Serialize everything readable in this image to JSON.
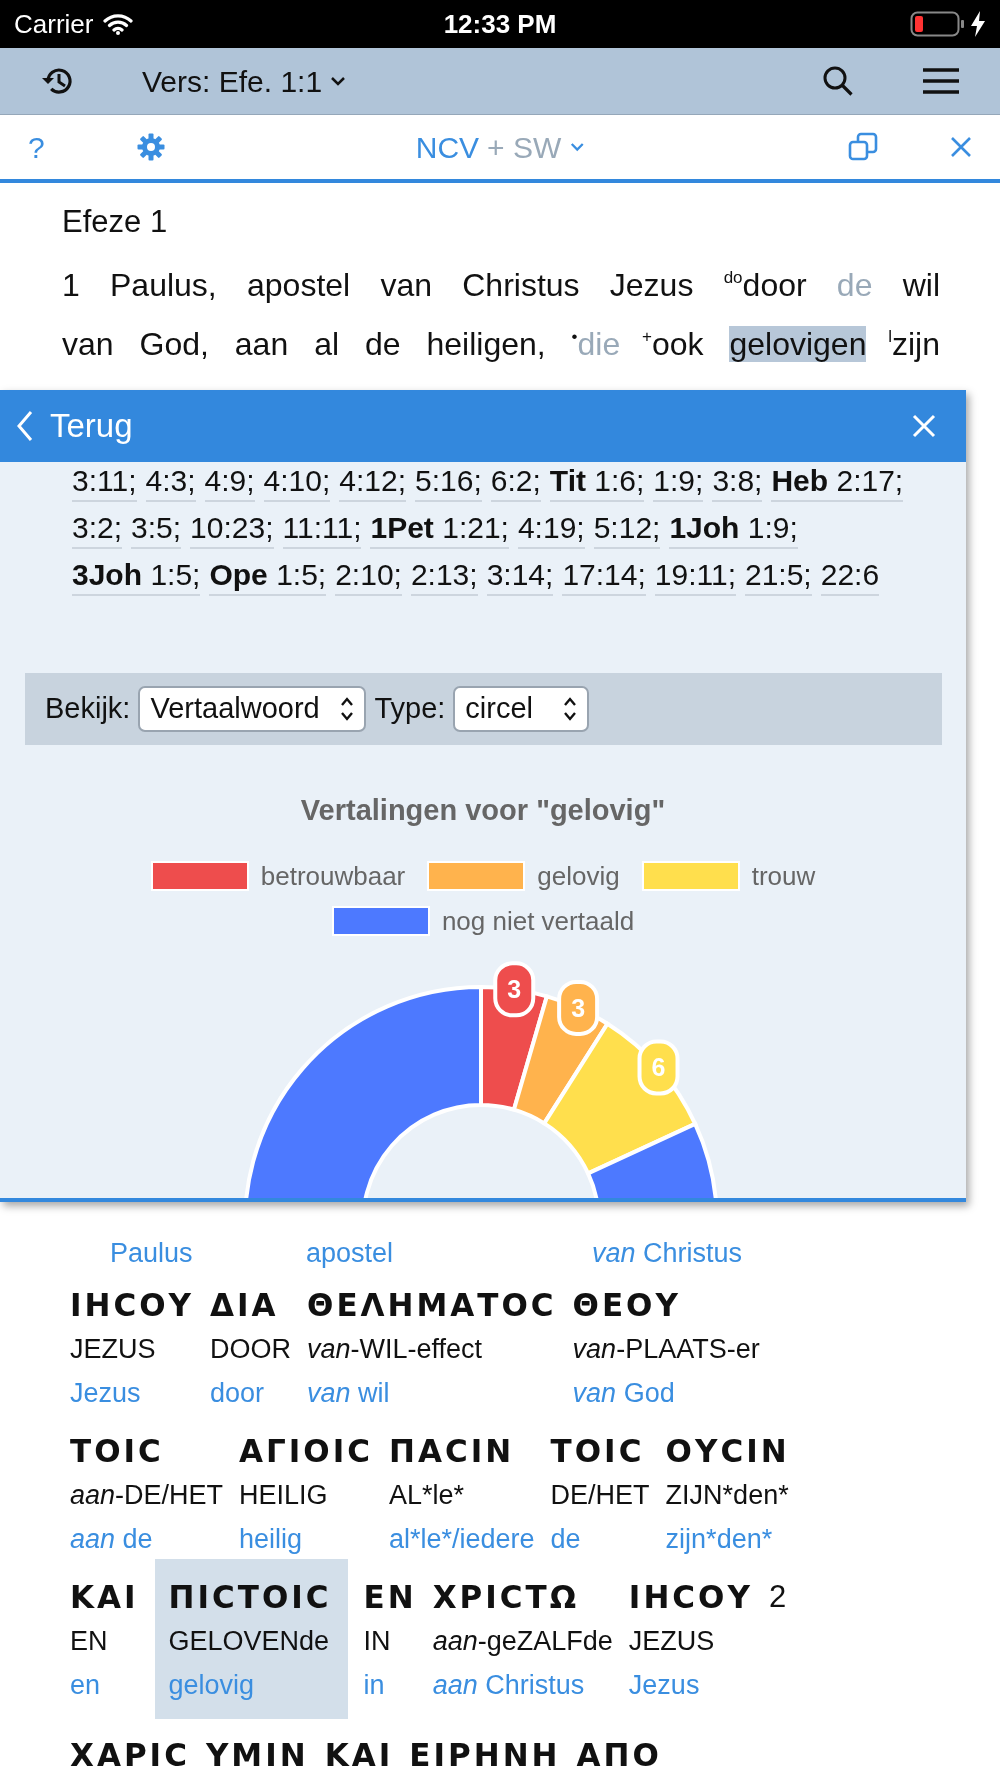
{
  "status_bar": {
    "carrier": "Carrier",
    "time": "12:33 PM"
  },
  "nav_bar": {
    "verse_picker": "Vers: Efe. 1:1"
  },
  "toolbar": {
    "help": "?",
    "translation": [
      {
        "text": "NCV",
        "active": true
      },
      {
        "text": "+ SW",
        "active": false
      }
    ]
  },
  "chapter_title": "Efeze 1",
  "verse_lines": [
    [
      {
        "kind": "text",
        "text": "1 Paulus, apostel van Christus Jezus "
      },
      {
        "kind": "marker",
        "text": "do"
      },
      {
        "kind": "text",
        "text": "door "
      },
      {
        "kind": "faded",
        "text": "de"
      },
      {
        "kind": "text",
        "text": " wil"
      }
    ],
    [
      {
        "kind": "text",
        "text": "van God, aan al de heiligen, "
      },
      {
        "kind": "marker",
        "text": "•"
      },
      {
        "kind": "faded",
        "text": "die"
      },
      {
        "kind": "marker",
        "text": " +"
      },
      {
        "kind": "text",
        "text": "ook "
      },
      {
        "kind": "highlight",
        "text": "gelovigen"
      },
      {
        "kind": "marker",
        "text": " l"
      },
      {
        "kind": "text",
        "text": "zijn"
      }
    ]
  ],
  "popup": {
    "back": "Terug",
    "references": [
      {
        "ref": "3:11;"
      },
      {
        "ref": "4:3;"
      },
      {
        "ref": "4:9;"
      },
      {
        "ref": "4:10;"
      },
      {
        "ref": "4:12;"
      },
      {
        "ref": "5:16;"
      },
      {
        "ref": "6:2;"
      },
      {
        "book": "Tit",
        "ref": "1:6;"
      },
      {
        "ref": "1:9;"
      },
      {
        "ref": "3:8;"
      },
      {
        "book": "Heb",
        "ref": "2:17;"
      },
      {
        "ref": "3:2;"
      },
      {
        "ref": "3:5;"
      },
      {
        "ref": "10:23;"
      },
      {
        "ref": "11:11;"
      },
      {
        "book": "1Pet",
        "ref": "1:21;"
      },
      {
        "ref": "4:19;"
      },
      {
        "ref": "5:12;"
      },
      {
        "book": "1Joh",
        "ref": "1:9;"
      },
      {
        "book": "3Joh",
        "ref": "1:5;"
      },
      {
        "book": "Ope",
        "ref": "1:5;"
      },
      {
        "ref": "2:10;"
      },
      {
        "ref": "2:13;"
      },
      {
        "ref": "3:14;"
      },
      {
        "ref": "17:14;"
      },
      {
        "ref": "19:11;"
      },
      {
        "ref": "21:5;"
      },
      {
        "ref": "22:6"
      }
    ],
    "filter": {
      "view_label": "Bekijk:",
      "view_value": "Vertaalwoord",
      "type_label": "Type:",
      "type_value": "circel"
    },
    "chart_data": {
      "type": "donut",
      "title": "Vertalingen voor \"gelovig\"",
      "categories": [
        "betrouwbaar",
        "gelovig",
        "trouw",
        "nog niet vertaald"
      ],
      "series": [
        {
          "values": [
            4.5,
            4.5,
            9.1,
            81.9
          ]
        }
      ],
      "colors": [
        "#ee4d4d",
        "#ffb34d",
        "#ffdf4d",
        "#4d79ff"
      ],
      "value_labels": [
        "3",
        "3",
        "6",
        null
      ],
      "legend": "top"
    }
  },
  "interlinear": [
    {
      "words": [
        {
          "kind": "word",
          "translation": "Paulus",
          "selected": false
        },
        {
          "kind": "word",
          "translation": "apostel",
          "selected": false
        },
        {
          "kind": "word",
          "translation": "*van* Christus",
          "selected": false
        }
      ]
    },
    {
      "words": [
        {
          "kind": "word",
          "greek": "ΙΗϹΟΥ",
          "gloss": "JEZUS",
          "translation": "Jezus",
          "selected": false
        },
        {
          "kind": "word",
          "greek": "ΔΙΑ",
          "gloss": "DOOR",
          "translation": "door",
          "selected": false
        },
        {
          "kind": "word",
          "greek": "ΘΕΛΗΜΑΤΟϹ",
          "gloss": "*van*-WIL-effect",
          "translation": "*van* wil",
          "selected": false
        },
        {
          "kind": "word",
          "greek": "ΘΕΟΥ",
          "gloss": "*van*-PLAATS-er",
          "translation": "*van* God",
          "selected": false
        }
      ]
    },
    {
      "words": [
        {
          "kind": "word",
          "greek": "ΤΟΙϹ",
          "gloss": "*aan*-DE/HET",
          "translation": "*aan* de",
          "selected": false
        },
        {
          "kind": "word",
          "greek": "ΑΓΙΟΙϹ",
          "gloss": "HEILIG",
          "translation": "heilig",
          "selected": false
        },
        {
          "kind": "word",
          "greek": "ΠΑϹΙΝ",
          "gloss": "AL*le*",
          "translation": "al*le*/iedere",
          "selected": false
        },
        {
          "kind": "word",
          "greek": "ΤΟΙϹ",
          "gloss": "DE/HET",
          "translation": "de",
          "selected": false
        },
        {
          "kind": "word",
          "greek": "ΟΥϹΙΝ",
          "gloss": "ZIJN*den*",
          "translation": "zijn*den*",
          "selected": false
        }
      ]
    },
    {
      "words": [
        {
          "kind": "word",
          "greek": "ΚΑΙ",
          "gloss": "EN",
          "translation": "en",
          "selected": false
        },
        {
          "kind": "word",
          "greek": "ΠΙϹΤΟΙϹ",
          "gloss": "GELOVENde",
          "translation": "gelovig",
          "selected": true
        },
        {
          "kind": "word",
          "greek": "ΕΝ",
          "gloss": "IN",
          "translation": "in",
          "selected": false
        },
        {
          "kind": "word",
          "greek": "ΧΡΙϹΤΩ",
          "gloss": "*aan*-geZALFde",
          "translation": "*aan* Christus",
          "selected": false
        },
        {
          "kind": "word",
          "greek": "ΙΗϹΟΥ",
          "gloss": "JEZUS",
          "translation": "Jezus",
          "selected": false
        },
        {
          "kind": "verse_number",
          "greek": "2",
          "selected": false
        }
      ]
    },
    {
      "words": [
        {
          "kind": "word",
          "greek": "ΧΑΡΙϹ",
          "selected": false
        },
        {
          "kind": "word",
          "greek": "ΥΜΙΝ",
          "selected": false
        },
        {
          "kind": "word",
          "greek": "ΚΑΙ",
          "selected": false
        },
        {
          "kind": "word",
          "greek": "ΕΙΡΗΝΗ",
          "selected": false
        },
        {
          "kind": "word",
          "greek": "ΑΠΟ",
          "selected": false
        }
      ]
    }
  ]
}
